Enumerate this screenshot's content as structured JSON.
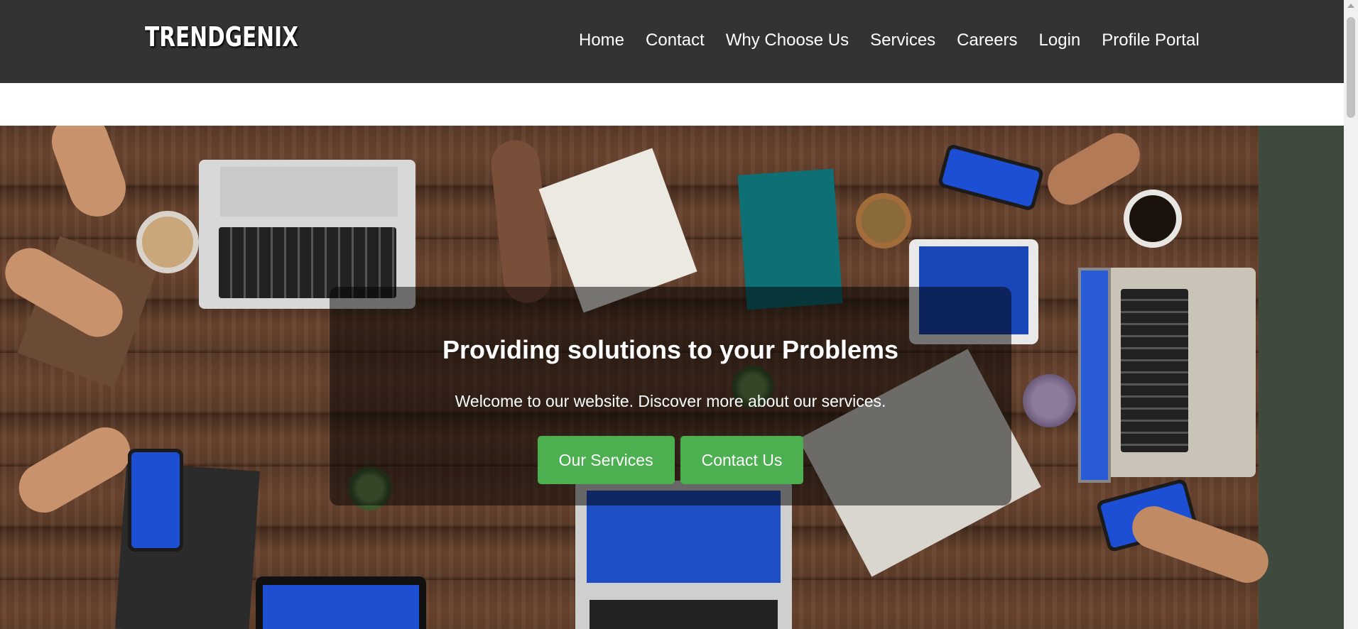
{
  "brand": {
    "logo_text": "TRENDGENIX"
  },
  "nav": {
    "items": [
      {
        "label": "Home"
      },
      {
        "label": "Contact"
      },
      {
        "label": "Why Choose Us"
      },
      {
        "label": "Services"
      },
      {
        "label": "Careers"
      },
      {
        "label": "Login"
      },
      {
        "label": "Profile Portal"
      }
    ]
  },
  "hero": {
    "title": "Providing solutions to your Problems",
    "subtitle": "Welcome to our website. Discover more about our services.",
    "primary_button": "Our Services",
    "secondary_button": "Contact Us",
    "background_image": "team-desk-meeting-photo"
  },
  "colors": {
    "navbar_bg": "#333333",
    "button_green": "#4caf50",
    "overlay": "rgba(0,0,0,0.5)",
    "text_light": "#ffffff"
  }
}
